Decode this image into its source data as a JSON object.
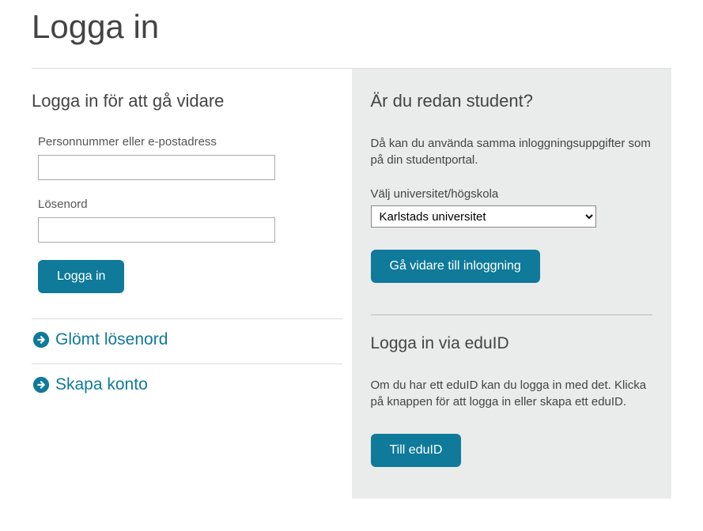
{
  "page_title": "Logga in",
  "left": {
    "heading": "Logga in för att gå vidare",
    "field_user_label": "Personnummer eller e-postadress",
    "user_value": "",
    "field_password_label": "Lösenord",
    "password_value": "",
    "login_button": "Logga in",
    "link_forgot": "Glömt lösenord",
    "link_create": "Skapa konto"
  },
  "right": {
    "heading": "Är du redan student?",
    "intro": "Då kan du använda samma inloggningsuppgifter som på din studentportal.",
    "uni_label": "Välj universitet/högskola",
    "uni_selected": "Karlstads universitet",
    "go_button": "Gå vidare till inloggning",
    "eduid_heading": "Logga in via eduID",
    "eduid_text": "Om du har ett eduID kan du logga in med det. Klicka på knappen för att logga in eller skapa ett eduID.",
    "eduid_button": "Till eduID"
  },
  "colors": {
    "accent": "#0f7a9a",
    "panel_bg": "#eaebeb"
  }
}
